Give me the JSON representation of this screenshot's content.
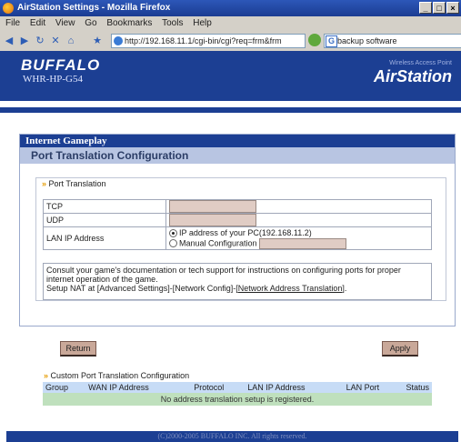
{
  "window": {
    "title": "AirStation Settings - Mozilla Firefox"
  },
  "menu": [
    "File",
    "Edit",
    "View",
    "Go",
    "Bookmarks",
    "Tools",
    "Help"
  ],
  "toolbar": {
    "url": "http://192.168.11.1/cgi-bin/cgi?req=frm&frm",
    "search": "backup software"
  },
  "banner": {
    "brand": "BUFFALO",
    "model": "WHR-HP-G54",
    "tagline": "Wireless Access Point",
    "product": "AirStation"
  },
  "page": {
    "title": "Internet Gameplay",
    "subtitle": "Port Translation Configuration"
  },
  "port_translation": {
    "section_title": "Port Translation",
    "tcp_label": "TCP",
    "udp_label": "UDP",
    "lan_ip_label": "LAN IP Address",
    "option_pc": "IP address of your PC(192.168.11.2)",
    "option_manual": "Manual Configuration",
    "note_line1": "Consult your game's documentation or tech support for instructions on configuring ports for proper internet operation of the game.",
    "note_line2_prefix": "Setup NAT at [Advanced Settings]-[Network Config]-[",
    "note_link": "Network Address Translation",
    "note_line2_suffix": "]."
  },
  "buttons": {
    "return": "Return",
    "apply": "Apply"
  },
  "custom": {
    "title": "Custom Port Translation Configuration",
    "columns": [
      "Group",
      "WAN IP Address",
      "Protocol",
      "LAN IP Address",
      "LAN Port",
      "Status"
    ],
    "empty_message": "No address translation setup is registered."
  },
  "footer": "(C)2000-2005 BUFFALO INC. All rights reserved."
}
